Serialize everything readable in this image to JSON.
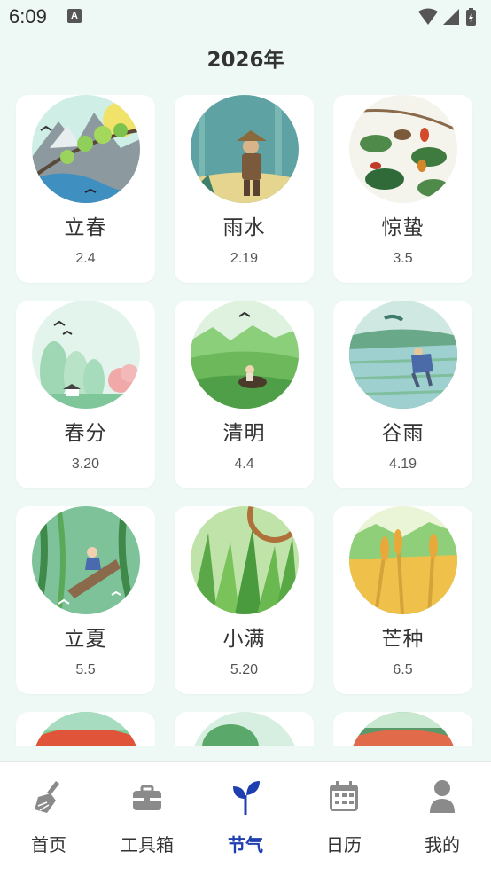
{
  "status": {
    "time": "6:09",
    "notification_letter": "A"
  },
  "header": {
    "title": "2026年"
  },
  "terms": [
    {
      "name": "立春",
      "date": "2.4"
    },
    {
      "name": "雨水",
      "date": "2.19"
    },
    {
      "name": "惊蛰",
      "date": "3.5"
    },
    {
      "name": "春分",
      "date": "3.20"
    },
    {
      "name": "清明",
      "date": "4.4"
    },
    {
      "name": "谷雨",
      "date": "4.19"
    },
    {
      "name": "立夏",
      "date": "5.5"
    },
    {
      "name": "小满",
      "date": "5.20"
    },
    {
      "name": "芒种",
      "date": "6.5"
    },
    {
      "name": "",
      "date": ""
    },
    {
      "name": "",
      "date": ""
    },
    {
      "name": "",
      "date": ""
    }
  ],
  "nav": {
    "items": [
      {
        "label": "首页",
        "icon": "broom-icon"
      },
      {
        "label": "工具箱",
        "icon": "toolbox-icon"
      },
      {
        "label": "节气",
        "icon": "sprout-icon"
      },
      {
        "label": "日历",
        "icon": "calendar-icon"
      },
      {
        "label": "我的",
        "icon": "person-icon"
      }
    ],
    "active_index": 2
  },
  "colors": {
    "background": "#eef8f5",
    "card": "#ffffff",
    "active": "#1f3fb0",
    "icon": "#8a8a8a"
  }
}
